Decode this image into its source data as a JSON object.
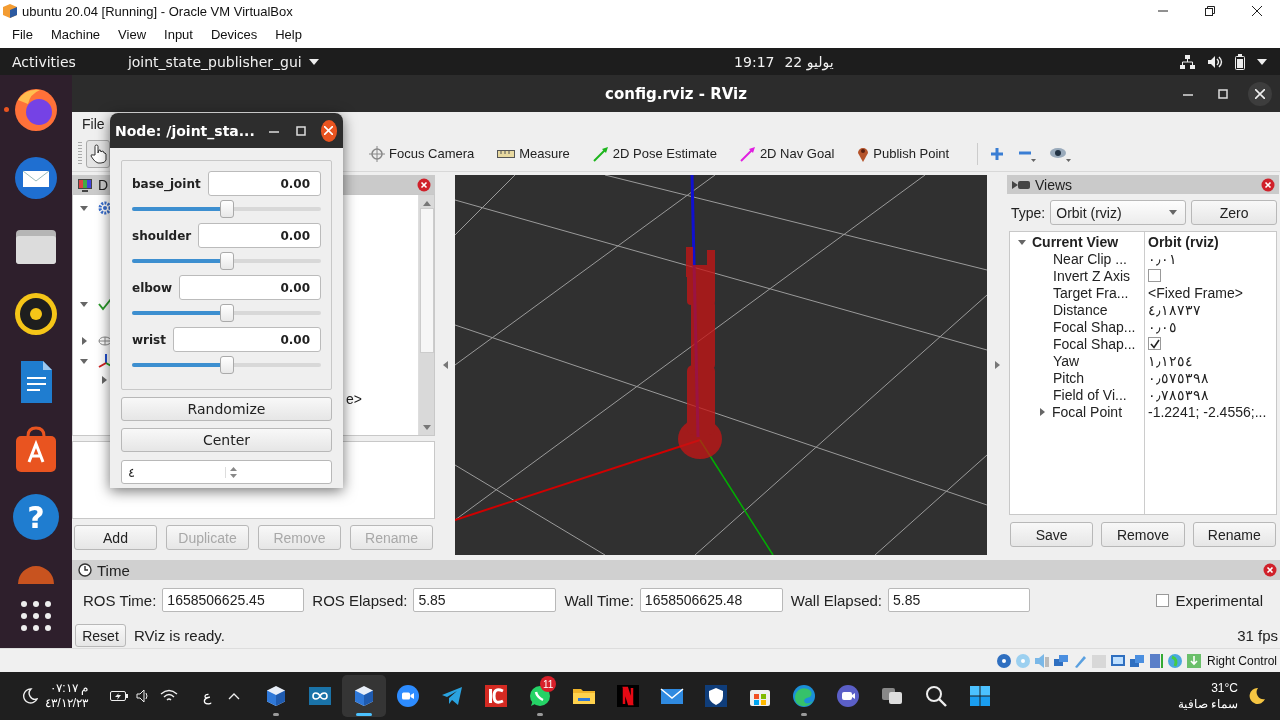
{
  "vm_window": {
    "title": "ubuntu 20.04 [Running] - Oracle VM VirtualBox",
    "menu": [
      "File",
      "Machine",
      "View",
      "Input",
      "Devices",
      "Help"
    ]
  },
  "top_bar": {
    "activities": "Activities",
    "app_menu": "joint_state_publisher_gui",
    "time": "19:17",
    "date": "22 يوليو"
  },
  "dock": [
    {
      "kind": "browser",
      "running": true
    },
    {
      "kind": "mail",
      "running": false
    },
    {
      "kind": "files",
      "running": false
    },
    {
      "kind": "speaker",
      "running": false
    },
    {
      "kind": "document",
      "running": false
    },
    {
      "kind": "store",
      "running": false
    },
    {
      "kind": "help",
      "label": "?",
      "running": false
    },
    {
      "kind": "partial",
      "running": false
    },
    {
      "kind": "apps",
      "running": false
    }
  ],
  "rviz": {
    "title": "config.rviz - RViz",
    "menu": [
      "File"
    ],
    "tools": [
      {
        "kind": "focus",
        "label": "Focus Camera"
      },
      {
        "kind": "measure",
        "label": "Measure"
      },
      {
        "kind": "pose",
        "label": "2D Pose Estimate"
      },
      {
        "kind": "nav",
        "label": "2D Nav Goal"
      },
      {
        "kind": "point",
        "label": "Publish Point"
      }
    ],
    "displays": {
      "title": "D",
      "tree": [
        {
          "kind": "gear",
          "expanded": true
        },
        {
          "kind": "check",
          "expanded": true
        },
        {
          "kind": "eye",
          "expanded": false
        },
        {
          "kind": "axes",
          "expanded": true,
          "children": [
            {
              "expanded": false
            },
            {
              "value": "e>"
            }
          ]
        }
      ],
      "buttons": [
        {
          "label": "Add",
          "disabled": false
        },
        {
          "label": "Duplicate",
          "disabled": true
        },
        {
          "label": "Remove",
          "disabled": true
        },
        {
          "label": "Rename",
          "disabled": true
        }
      ]
    },
    "views": {
      "title": "Views",
      "type_label": "Type:",
      "type_value": "Orbit (rviz)",
      "zero": "Zero",
      "tree": {
        "name": "Current View",
        "value": "Orbit (rviz)",
        "expanded": true,
        "children": [
          {
            "name": "Near Clip ...",
            "kind": "text",
            "value": "٠٫٠١"
          },
          {
            "name": "Invert Z Axis",
            "kind": "checkbox",
            "checked": false
          },
          {
            "name": "Target Fra...",
            "kind": "text",
            "value": "<Fixed Frame>"
          },
          {
            "name": "Distance",
            "kind": "text",
            "value": "٤٫١٨٧٣٧"
          },
          {
            "name": "Focal Shap...",
            "kind": "text",
            "value": "٠٫٠٥"
          },
          {
            "name": "Focal Shap...",
            "kind": "checkbox",
            "checked": true
          },
          {
            "name": "Yaw",
            "kind": "text",
            "value": "١٫١٢٥٤"
          },
          {
            "name": "Pitch",
            "kind": "text",
            "value": "٠٫٥٧٥٣٩٨"
          },
          {
            "name": "Field of Vi...",
            "kind": "text",
            "value": "٠٫٧٨٥٣٩٨"
          },
          {
            "name": "Focal Point",
            "kind": "text",
            "value": "-1.2241; -2.4556;...",
            "expanded": false
          }
        ]
      },
      "buttons": [
        "Save",
        "Remove",
        "Rename"
      ]
    },
    "time": {
      "title": "Time",
      "fields": [
        {
          "label": "ROS Time:",
          "value": "1658506625.45"
        },
        {
          "label": "ROS Elapsed:",
          "value": "5.85"
        },
        {
          "label": "Wall Time:",
          "value": "1658506625.48"
        },
        {
          "label": "Wall Elapsed:",
          "value": "5.85"
        }
      ],
      "experimental": {
        "label": "Experimental",
        "checked": false
      },
      "reset": "Reset",
      "status": "RViz is ready.",
      "fps": "31 fps"
    }
  },
  "node_dialog": {
    "title": "Node: /joint_sta...",
    "joints": [
      {
        "name": "base_joint",
        "value": "0.00",
        "level": 0.5
      },
      {
        "name": "shoulder",
        "value": "0.00",
        "level": 0.5
      },
      {
        "name": "elbow",
        "value": "0.00",
        "level": 0.5
      },
      {
        "name": "wrist",
        "value": "0.00",
        "level": 0.5
      }
    ],
    "buttons": [
      "Randomize",
      "Center"
    ],
    "spin_value": "٤"
  },
  "vm_status": {
    "host_key": "Right Control"
  },
  "taskbar": {
    "time": "٠٧:١٧ م",
    "date": "٤٣/١٢/٢٣",
    "language": "ع",
    "apps": [
      {
        "kind": "cube",
        "running": true,
        "selected": false
      },
      {
        "kind": "infinity",
        "running": false,
        "selected": false
      },
      {
        "kind": "cube",
        "running": true,
        "selected": true
      },
      {
        "kind": "video",
        "running": false,
        "selected": false
      },
      {
        "kind": "plane",
        "running": false,
        "selected": false
      },
      {
        "kind": "redsquare",
        "running": false,
        "selected": false
      },
      {
        "kind": "chat",
        "running": true,
        "selected": false,
        "badge": "11"
      },
      {
        "kind": "folder",
        "running": false,
        "selected": false
      },
      {
        "kind": "stripes",
        "running": false,
        "selected": false
      },
      {
        "kind": "envelope",
        "running": false,
        "selected": false
      },
      {
        "kind": "shield",
        "running": false,
        "selected": false
      },
      {
        "kind": "bag",
        "running": false,
        "selected": false
      },
      {
        "kind": "wave",
        "running": true,
        "selected": false
      },
      {
        "kind": "videochat",
        "running": false,
        "selected": false
      },
      {
        "kind": "windows",
        "running": false,
        "selected": false
      },
      {
        "kind": "search",
        "running": false,
        "selected": false
      },
      {
        "kind": "start",
        "running": false,
        "selected": false
      }
    ],
    "weather": {
      "temperature": "31°C",
      "condition": "سماء صافية"
    }
  }
}
